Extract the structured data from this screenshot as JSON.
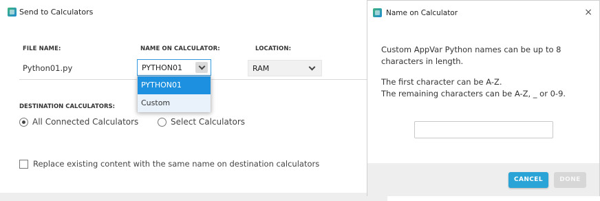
{
  "send_window": {
    "title": "Send to Calculators",
    "columns": {
      "file_name": "FILE NAME:",
      "name_on_calculator": "NAME ON CALCULATOR:",
      "location": "LOCATION:"
    },
    "file_row": {
      "file_name": "Python01.py",
      "name_selected": "PYTHON01",
      "location_selected": "RAM"
    },
    "name_dropdown_options": [
      "PYTHON01",
      "Custom"
    ],
    "destination_label": "DESTINATION CALCULATORS:",
    "radio_options": [
      "All Connected Calculators",
      "Select Calculators"
    ],
    "radio_selected": "All Connected Calculators",
    "replace_checkbox_label": "Replace existing content with the same name on destination calculators",
    "replace_checked": false
  },
  "dialog": {
    "title": "Name on Calculator",
    "paragraph1": "Custom AppVar Python names can be up to 8 characters in length.",
    "paragraph2_line1": "The first character can be A-Z.",
    "paragraph2_line2": "The remaining characters can be A-Z, _ or 0-9.",
    "input_value": "",
    "cancel_label": "CANCEL",
    "done_label": "DONE",
    "done_enabled": false,
    "close_glyph": "×"
  },
  "colors": {
    "accent": "#1e90e0",
    "cancel_button": "#2aa3d6",
    "disabled_button": "#d7d7d7"
  },
  "icons": [
    "app-icon",
    "chevron-down-icon",
    "close-icon"
  ]
}
